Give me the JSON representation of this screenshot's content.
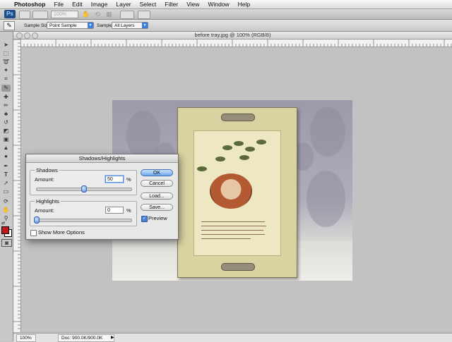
{
  "menubar": {
    "apple": "",
    "app_name": "Photoshop",
    "items": [
      "File",
      "Edit",
      "Image",
      "Layer",
      "Select",
      "Filter",
      "View",
      "Window",
      "Help"
    ]
  },
  "appbar": {
    "logo": "Ps",
    "zoom": "100%"
  },
  "options_bar": {
    "sample_size_label": "Sample Size:",
    "sample_size_value": "Point Sample",
    "sample_label": "Sample:",
    "sample_value": "All Layers"
  },
  "document": {
    "title": "before tray.jpg @ 100% (RGB/8)",
    "status_zoom": "100%",
    "status_doc": "Doc: 900.0K/900.0K"
  },
  "toolbox": {
    "foreground_color": "#c0181a",
    "background_color": "#ffffff"
  },
  "dialog": {
    "title": "Shadows/Highlights",
    "shadows": {
      "label": "Shadows",
      "amount_label": "Amount:",
      "amount_value": "50",
      "unit": "%",
      "slider_level": 0.5
    },
    "highlights": {
      "label": "Highlights",
      "amount_label": "Amount:",
      "amount_value": "0",
      "unit": "%",
      "slider_level": 0.0
    },
    "show_more_label": "Show More Options",
    "show_more_checked": false,
    "buttons": {
      "ok": "OK",
      "cancel": "Cancel",
      "load": "Load...",
      "save": "Save..."
    },
    "preview_label": "Preview",
    "preview_checked": true
  },
  "colors": {
    "accent": "#4b82d8",
    "canvas_bg": "#c2c2c2"
  }
}
